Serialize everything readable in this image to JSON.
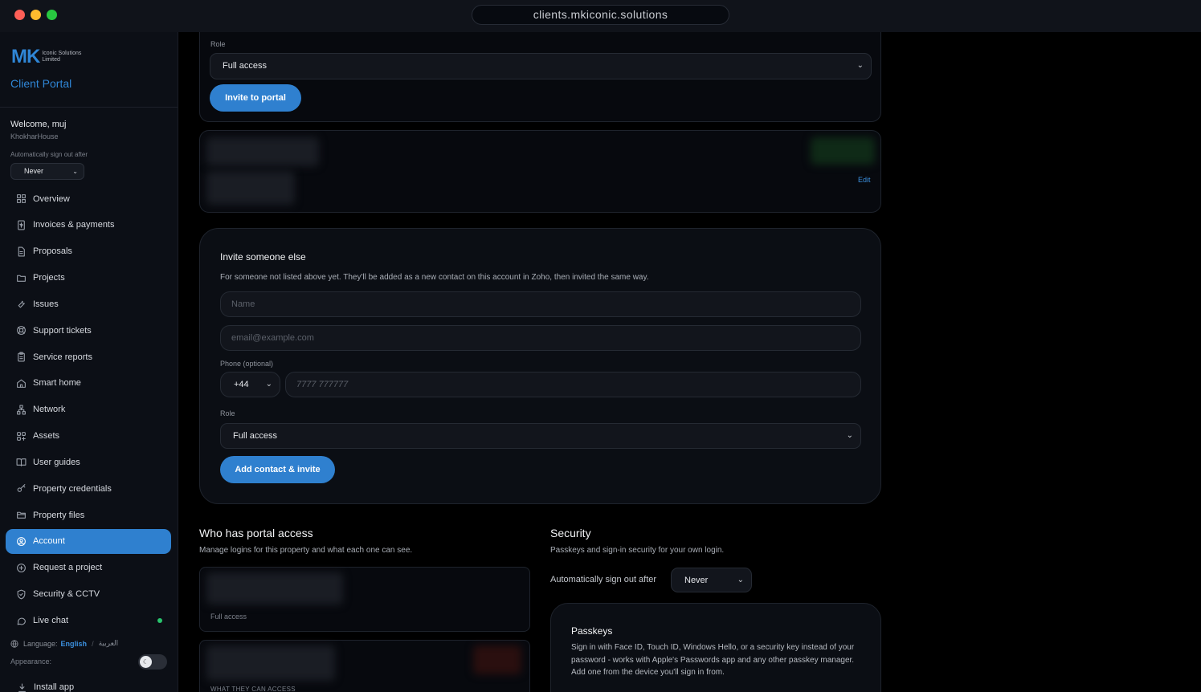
{
  "browser": {
    "url": "clients.mkiconic.solutions"
  },
  "brand": {
    "logo_text": "MK",
    "logo_subtitle": "Iconic Solutions Limited",
    "portal_title": "Client Portal",
    "accent_color": "#2f80cf"
  },
  "user": {
    "welcome": "Welcome, muj",
    "property": "KhokharHouse",
    "signout_label": "Automatically sign out after",
    "signout_value": "Never"
  },
  "sidebar": {
    "items": [
      {
        "label": "Overview",
        "icon": "grid-icon"
      },
      {
        "label": "Invoices & payments",
        "icon": "invoice-icon"
      },
      {
        "label": "Proposals",
        "icon": "document-icon"
      },
      {
        "label": "Projects",
        "icon": "folder-icon"
      },
      {
        "label": "Issues",
        "icon": "wrench-icon"
      },
      {
        "label": "Support tickets",
        "icon": "lifebuoy-icon"
      },
      {
        "label": "Service reports",
        "icon": "clipboard-icon"
      },
      {
        "label": "Smart home",
        "icon": "home-icon"
      },
      {
        "label": "Network",
        "icon": "network-icon"
      },
      {
        "label": "Assets",
        "icon": "assets-icon"
      },
      {
        "label": "User guides",
        "icon": "book-icon"
      },
      {
        "label": "Property credentials",
        "icon": "key-icon"
      },
      {
        "label": "Property files",
        "icon": "folder-open-icon"
      },
      {
        "label": "Account",
        "icon": "user-circle-icon",
        "active": true
      },
      {
        "label": "Request a project",
        "icon": "plus-circle-icon"
      },
      {
        "label": "Security & CCTV",
        "icon": "shield-icon"
      },
      {
        "label": "Live chat",
        "icon": "chat-icon"
      }
    ],
    "language_label": "Language:",
    "language_current": "English",
    "language_alt": "العربية",
    "appearance_label": "Appearance:",
    "install_label": "Install app"
  },
  "invite_existing": {
    "role_label": "Role",
    "role_value": "Full access",
    "invite_button": "Invite to portal",
    "edit_link": "Edit"
  },
  "invite_new": {
    "title": "Invite someone else",
    "description": "For someone not listed above yet. They'll be added as a new contact on this account in Zoho, then invited the same way.",
    "name_placeholder": "Name",
    "email_placeholder": "email@example.com",
    "phone_label": "Phone (optional)",
    "country_code": "+44",
    "phone_placeholder": "7777 777777",
    "role_label": "Role",
    "role_value": "Full access",
    "submit_button": "Add contact & invite"
  },
  "portal_access": {
    "title": "Who has portal access",
    "description": "Manage logins for this property and what each one can see.",
    "entry_role": "Full access",
    "what_they_can_access": "WHAT THEY CAN ACCESS"
  },
  "security": {
    "title": "Security",
    "description": "Passkeys and sign-in security for your own login.",
    "signout_label": "Automatically sign out after",
    "signout_value": "Never",
    "passkeys_title": "Passkeys",
    "passkeys_body": "Sign in with Face ID, Touch ID, Windows Hello, or a security key instead of your password - works with Apple's Passwords app and any other passkey manager. Add one from the device you'll sign in from."
  }
}
